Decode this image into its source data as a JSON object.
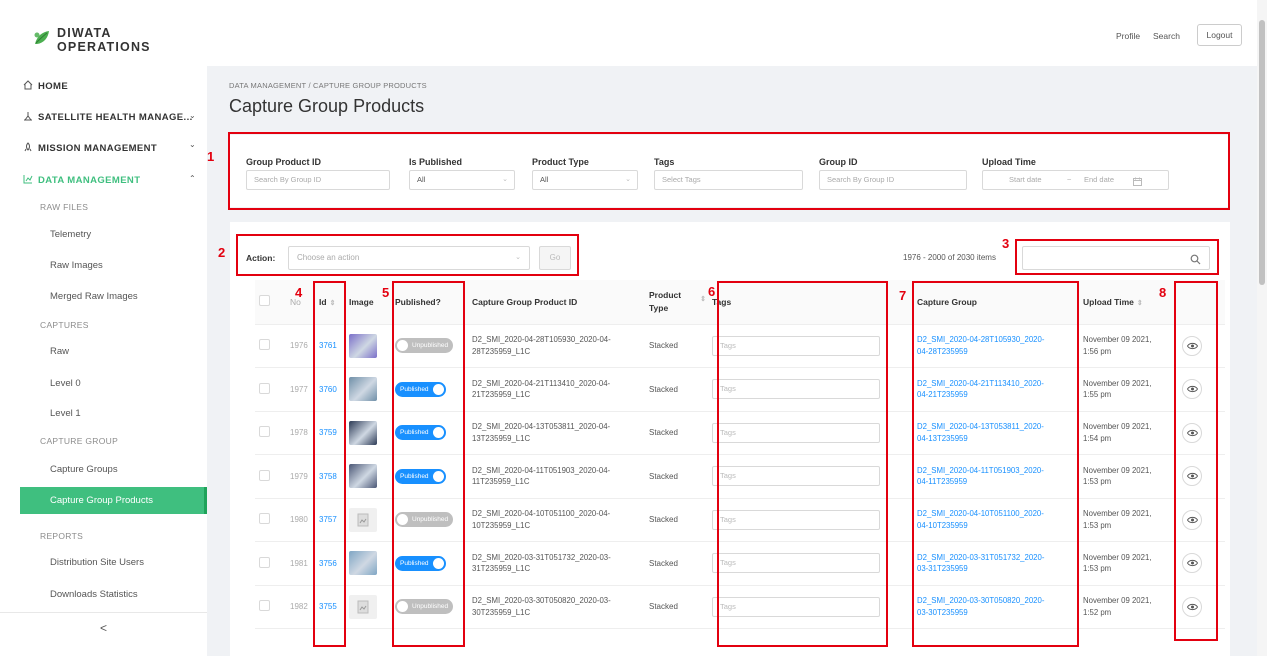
{
  "brand": {
    "name": "DIWATA OPERATIONS"
  },
  "sidebar": {
    "nav": [
      {
        "label": "HOME"
      },
      {
        "label": "SATELLITE HEALTH MANAGE..."
      },
      {
        "label": "MISSION MANAGEMENT"
      },
      {
        "label": "DATA MANAGEMENT"
      }
    ],
    "sections": {
      "raw_files": "RAW FILES",
      "captures": "CAPTURES",
      "capture_group": "CAPTURE GROUP",
      "reports": "REPORTS"
    },
    "items": {
      "telemetry": "Telemetry",
      "raw_images": "Raw Images",
      "merged_raw_images": "Merged Raw Images",
      "raw": "Raw",
      "level0": "Level 0",
      "level1": "Level 1",
      "capture_groups": "Capture Groups",
      "capture_group_products": "Capture Group Products",
      "distribution_site_users": "Distribution Site Users",
      "downloads_statistics": "Downloads Statistics"
    },
    "collapse": "<"
  },
  "topbar": {
    "profile": "Profile",
    "search": "Search",
    "logout": "Logout"
  },
  "breadcrumb": "DATA MANAGEMENT / CAPTURE GROUP PRODUCTS",
  "page_title": "Capture Group Products",
  "filters": {
    "group_product_id": {
      "label": "Group Product ID",
      "placeholder": "Search By Group ID"
    },
    "is_published": {
      "label": "Is Published",
      "value": "All"
    },
    "product_type": {
      "label": "Product Type",
      "value": "All"
    },
    "tags": {
      "label": "Tags",
      "placeholder": "Select Tags"
    },
    "group_id": {
      "label": "Group ID",
      "placeholder": "Search By Group ID"
    },
    "upload_time": {
      "label": "Upload Time",
      "start": "Start date",
      "sep": "~",
      "end": "End date"
    }
  },
  "actions": {
    "label": "Action:",
    "placeholder": "Choose an action",
    "go": "Go"
  },
  "pagination": {
    "items": "1976 - 2000 of 2030 items"
  },
  "table": {
    "headers": {
      "no": "No",
      "id": "Id",
      "image": "Image",
      "published": "Published?",
      "cgp_id": "Capture Group Product ID",
      "product_type_1": "Product",
      "product_type_2": "Type",
      "tags": "Tags",
      "capture_group": "Capture Group",
      "upload_time": "Upload Time"
    },
    "tags_placeholder": "Tags",
    "rows": [
      {
        "no": "1976",
        "id": "3761",
        "published": false,
        "pub_label": "Unpublished",
        "cgp_1": "D2_SMI_2020-04-28T105930_2020-04-",
        "cgp_2": "28T235959_L1C",
        "type": "Stacked",
        "cg_1": "D2_SMI_2020-04-28T105930_2020-",
        "cg_2": "04-28T235959",
        "time_1": "November 09 2021,",
        "time_2": "1:56 pm",
        "thumb": "#7a6fc9"
      },
      {
        "no": "1977",
        "id": "3760",
        "published": true,
        "pub_label": "Published",
        "cgp_1": "D2_SMI_2020-04-21T113410_2020-04-",
        "cgp_2": "21T235959_L1C",
        "type": "Stacked",
        "cg_1": "D2_SMI_2020-04-21T113410_2020-",
        "cg_2": "04-21T235959",
        "time_1": "November 09 2021,",
        "time_2": "1:55 pm",
        "thumb": "#6f8fa8"
      },
      {
        "no": "1978",
        "id": "3759",
        "published": true,
        "pub_label": "Published",
        "cgp_1": "D2_SMI_2020-04-13T053811_2020-04-",
        "cgp_2": "13T235959_L1C",
        "type": "Stacked",
        "cg_1": "D2_SMI_2020-04-13T053811_2020-",
        "cg_2": "04-13T235959",
        "time_1": "November 09 2021,",
        "time_2": "1:54 pm",
        "thumb": "#2c3a55"
      },
      {
        "no": "1979",
        "id": "3758",
        "published": true,
        "pub_label": "Published",
        "cgp_1": "D2_SMI_2020-04-11T051903_2020-04-",
        "cgp_2": "11T235959_L1C",
        "type": "Stacked",
        "cg_1": "D2_SMI_2020-04-11T051903_2020-",
        "cg_2": "04-11T235959",
        "time_1": "November 09 2021,",
        "time_2": "1:53 pm",
        "thumb": "#4a5675"
      },
      {
        "no": "1980",
        "id": "3757",
        "published": false,
        "pub_label": "Unpublished",
        "cgp_1": "D2_SMI_2020-04-10T051100_2020-04-",
        "cgp_2": "10T235959_L1C",
        "type": "Stacked",
        "cg_1": "D2_SMI_2020-04-10T051100_2020-",
        "cg_2": "04-10T235959",
        "time_1": "November 09 2021,",
        "time_2": "1:53 pm",
        "thumb": "#e8e8e8"
      },
      {
        "no": "1981",
        "id": "3756",
        "published": true,
        "pub_label": "Published",
        "cgp_1": "D2_SMI_2020-03-31T051732_2020-03-",
        "cgp_2": "31T235959_L1C",
        "type": "Stacked",
        "cg_1": "D2_SMI_2020-03-31T051732_2020-",
        "cg_2": "03-31T235959",
        "time_1": "November 09 2021,",
        "time_2": "1:53 pm",
        "thumb": "#7fa6c4"
      },
      {
        "no": "1982",
        "id": "3755",
        "published": false,
        "pub_label": "Unpublished",
        "cgp_1": "D2_SMI_2020-03-30T050820_2020-03-",
        "cgp_2": "30T235959_L1C",
        "type": "Stacked",
        "cg_1": "D2_SMI_2020-03-30T050820_2020-",
        "cg_2": "03-30T235959",
        "time_1": "November 09 2021,",
        "time_2": "1:52 pm",
        "thumb": "#e8e8e8"
      }
    ]
  },
  "annotations": [
    "1",
    "2",
    "3",
    "4",
    "5",
    "6",
    "7",
    "8"
  ],
  "colors": {
    "accent": "#1890ff",
    "active": "#3fbf7f",
    "highlight": "#e3000f",
    "brand_icon": "#4caf50"
  },
  "icons": {
    "logo": "leaf-logo-icon",
    "home": "home-icon",
    "satellite": "satellite-icon",
    "mission": "rocket-icon",
    "data": "chart-icon",
    "search": "search-icon",
    "calendar": "calendar-icon",
    "view": "eye-icon"
  }
}
